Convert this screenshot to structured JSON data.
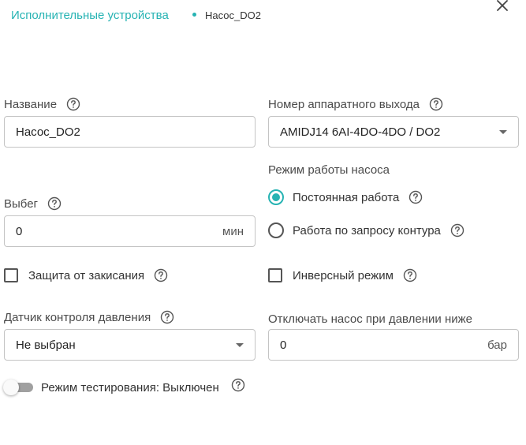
{
  "breadcrumb": {
    "parent": "Исполнительные устройства",
    "current": "Насос_DO2"
  },
  "icons": {
    "close": "close-icon",
    "help": "help-circle-icon",
    "dropdown": "chevron-down-icon"
  },
  "colors": {
    "accent": "#26b3b3",
    "border": "#c4c4c4",
    "text": "#222222"
  },
  "form": {
    "name": {
      "label": "Название",
      "value": "Насос_DO2"
    },
    "hardware_output": {
      "label": "Номер аппаратного выхода",
      "value": "AMIDJ14 6AI-4DO-4DO / DO2"
    },
    "runout": {
      "label": "Выбег",
      "value": "0",
      "unit": "мин"
    },
    "pump_mode": {
      "label": "Режим работы насоса",
      "options": [
        {
          "label": "Постоянная работа",
          "checked": true
        },
        {
          "label": "Работа по запросу контура",
          "checked": false
        }
      ]
    },
    "anti_seize": {
      "label": "Защита от закисания",
      "checked": false
    },
    "inverse": {
      "label": "Инверсный режим",
      "checked": false
    },
    "pressure_sensor": {
      "label": "Датчик контроля давления",
      "value": "Не выбран"
    },
    "pressure_cutoff": {
      "label": "Отключать насос при давлении ниже",
      "value": "0",
      "unit": "бар"
    },
    "test_mode": {
      "label": "Режим тестирования: Выключен",
      "enabled": false
    }
  }
}
